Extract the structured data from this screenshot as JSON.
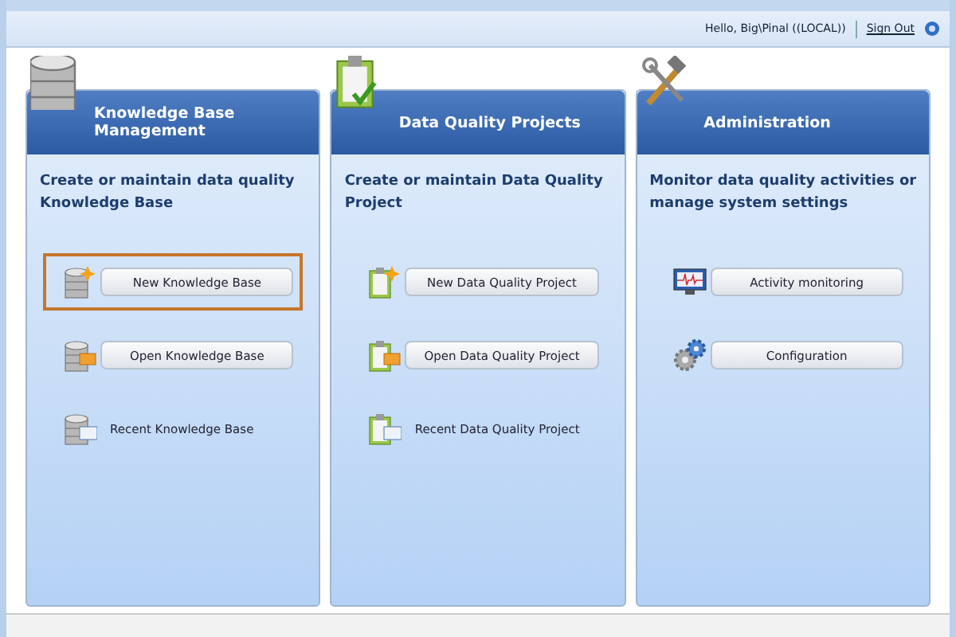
{
  "header": {
    "greeting": "Hello, Big\\Pinal ((LOCAL))",
    "sign_out": "Sign Out"
  },
  "panels": [
    {
      "title": "Knowledge Base Management",
      "description": "Create or maintain data quality Knowledge Base",
      "items": [
        {
          "label": "New Knowledge Base",
          "kind": "button",
          "highlighted": true
        },
        {
          "label": "Open Knowledge Base",
          "kind": "button",
          "highlighted": false
        },
        {
          "label": "Recent Knowledge Base",
          "kind": "link",
          "highlighted": false
        }
      ]
    },
    {
      "title": "Data Quality Projects",
      "description": "Create or maintain Data Quality Project",
      "items": [
        {
          "label": "New Data Quality Project",
          "kind": "button",
          "highlighted": false
        },
        {
          "label": "Open Data Quality Project",
          "kind": "button",
          "highlighted": false
        },
        {
          "label": "Recent Data Quality Project",
          "kind": "link",
          "highlighted": false
        }
      ]
    },
    {
      "title": "Administration",
      "description": "Monitor data quality activities or manage system settings",
      "items": [
        {
          "label": "Activity monitoring",
          "kind": "button",
          "highlighted": false
        },
        {
          "label": "Configuration",
          "kind": "button",
          "highlighted": false
        }
      ]
    }
  ]
}
